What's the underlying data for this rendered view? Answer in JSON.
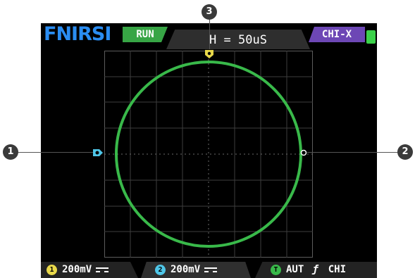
{
  "header": {
    "logo": "FNIRSI",
    "run_label": "RUN",
    "time_base": "H = 50uS",
    "mode": "CHI-X"
  },
  "footer": {
    "ch1_index": "1",
    "ch1_scale": "200mV",
    "ch2_index": "2",
    "ch2_scale": "200mV",
    "trigger_badge": "T",
    "trigger_mode": "AUT",
    "trigger_edge": "ƒ",
    "trigger_source": "CHI"
  },
  "callouts": [
    "1",
    "2",
    "3"
  ],
  "colors": {
    "trace": "#39b94a",
    "ch1_marker": "#4fc6e8",
    "trigger_marker": "#e8d84a",
    "logo": "#2a8df2",
    "run_bg": "#37a545",
    "mode_bg": "#6d47b5"
  },
  "icons": {
    "battery": "battery-icon",
    "dc_coupling": "dc-coupling-icon",
    "edge": "rising-edge-icon"
  }
}
